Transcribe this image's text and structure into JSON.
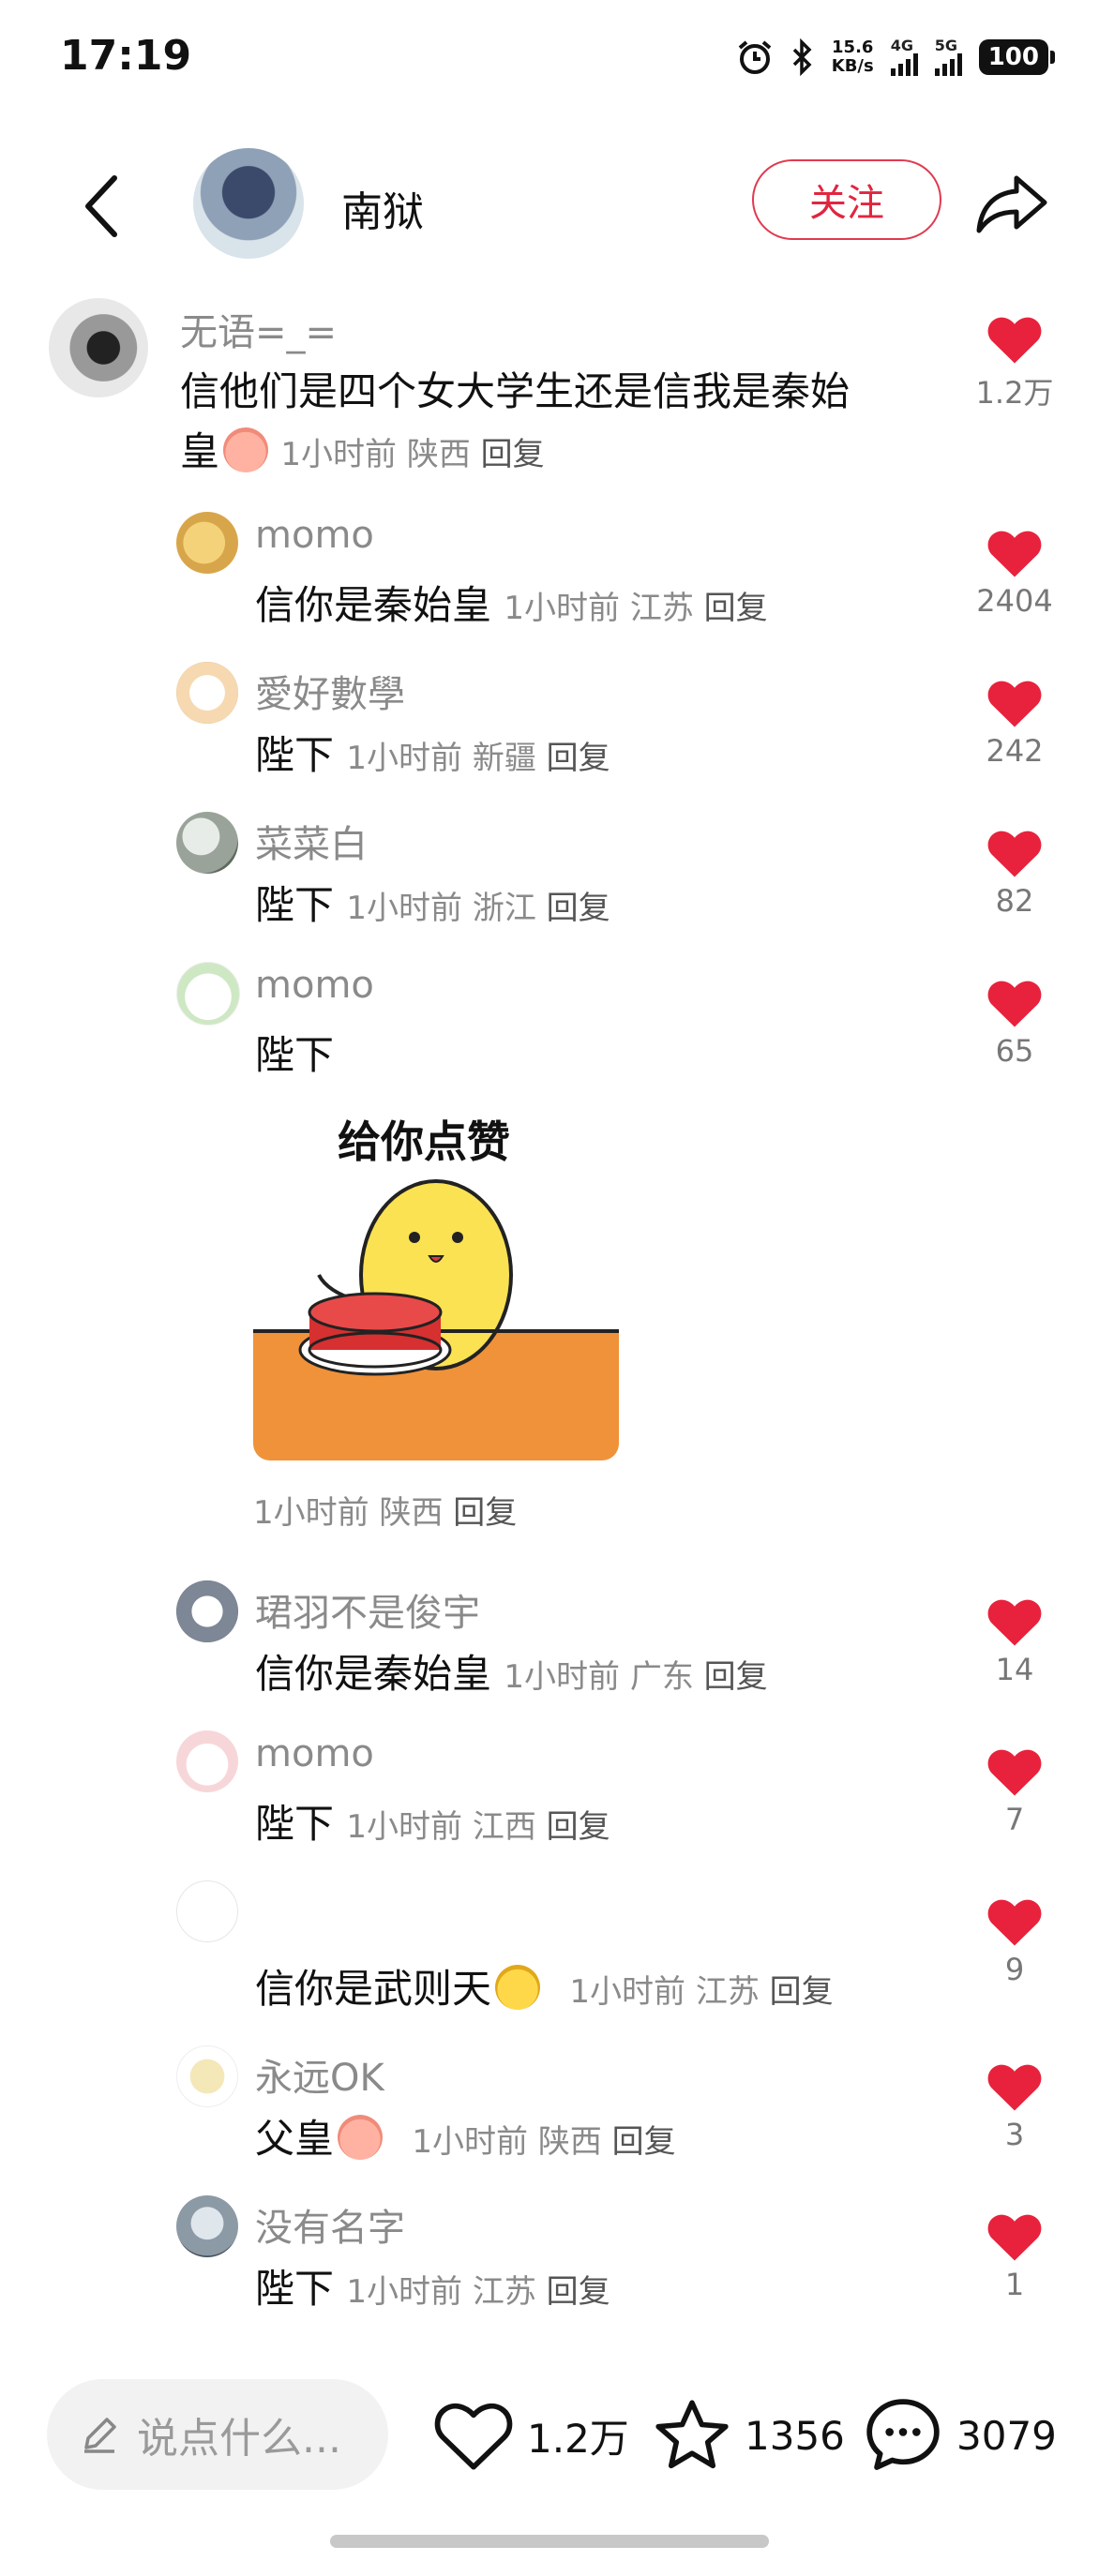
{
  "status_bar": {
    "time": "17:19",
    "net_speed": "15.6",
    "net_unit": "KB/s",
    "sig1": "4G",
    "sig2": "5G",
    "battery": "100"
  },
  "header": {
    "name": "南狱",
    "follow_label": "关注"
  },
  "comments": [
    {
      "user": "无语=_=",
      "text": "信他们是四个女大学生还是信我是秦始",
      "text2": "皇",
      "time": "1小时前",
      "region": "陕西",
      "reply": "回复",
      "likes": "1.2万"
    },
    {
      "user": "momo",
      "text": "信你是秦始皇",
      "time": "1小时前",
      "region": "江苏",
      "reply": "回复",
      "likes": "2404"
    },
    {
      "user": "愛好數學",
      "text": "陛下",
      "time": "1小时前",
      "region": "新疆",
      "reply": "回复",
      "likes": "242"
    },
    {
      "user": "菜菜白",
      "text": "陛下",
      "time": "1小时前",
      "region": "浙江",
      "reply": "回复",
      "likes": "82"
    },
    {
      "user": "momo",
      "text": "陛下",
      "sticker_text": "给你点赞",
      "time": "1小时前",
      "region": "陕西",
      "reply": "回复",
      "likes": "65"
    },
    {
      "user": "珺羽不是俊宇",
      "text": "信你是秦始皇",
      "time": "1小时前",
      "region": "广东",
      "reply": "回复",
      "likes": "14"
    },
    {
      "user": "momo",
      "text": "陛下",
      "time": "1小时前",
      "region": "江西",
      "reply": "回复",
      "likes": "7"
    },
    {
      "user": "",
      "text": "信你是武则天",
      "time": "1小时前",
      "region": "江苏",
      "reply": "回复",
      "likes": "9"
    },
    {
      "user": "永远OK",
      "text": "父皇",
      "time": "1小时前",
      "region": "陕西",
      "reply": "回复",
      "likes": "3"
    },
    {
      "user": "没有名字",
      "text": "陛下",
      "time": "1小时前",
      "region": "江苏",
      "reply": "回复",
      "likes": "1"
    }
  ],
  "bottom_bar": {
    "input_placeholder": "说点什么...",
    "likes": "1.2万",
    "favorites": "1356",
    "comments": "3079"
  },
  "colors": {
    "accent": "#e8223c",
    "muted": "#8a8a8a"
  }
}
